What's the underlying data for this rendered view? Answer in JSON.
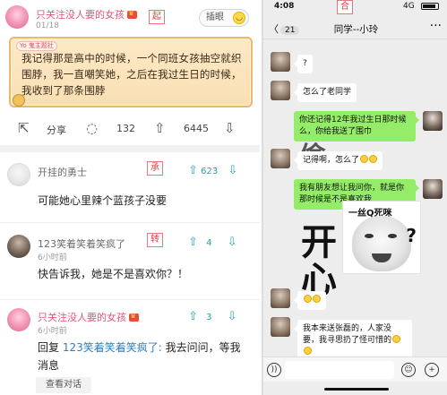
{
  "left": {
    "post": {
      "username": "只关注没人要的女孩",
      "date": "01/18",
      "tag": "起",
      "insert_label": "插眼",
      "parchment_label": "Yo 鬼主题社",
      "content": "我记得那是高中的时候，一个同班女孩抽空就织围脖，我一直嘲笑她，之后在我过生日的时候，我收到了那条围脖",
      "actions": {
        "share_label": "分享",
        "comments": "132",
        "upvotes": "6445"
      }
    },
    "comments": [
      {
        "username": "开挂的勇士",
        "tag": "承",
        "votes": "623",
        "text": "可能她心里辣个蓝孩子没要"
      },
      {
        "username": "123笑着笑着笑疯了",
        "time": "6小时前",
        "tag": "转",
        "votes": "4",
        "text": "快告诉我，她是不是喜欢你？！"
      },
      {
        "username": "只关注没人要的女孩",
        "time": "6小时前",
        "votes": "3",
        "reply_prefix": "回复",
        "reply_to": "123笑着笑着笑疯了:",
        "text_line1": "我去问问，等我",
        "text_line2": "消息",
        "view_label": "查看对话"
      }
    ]
  },
  "right": {
    "status": {
      "time": "4:08",
      "signal": "4G"
    },
    "tag": "合",
    "back_label": "〈",
    "back_badge": "21",
    "title": "同学--小玲",
    "more_label": "···",
    "messages": [
      {
        "dir": "in",
        "text": "?"
      },
      {
        "dir": "in",
        "text": "怎么了老同学"
      },
      {
        "dir": "out",
        "text": "你还记得12年我过生日那时候么，你给我送了围巾"
      },
      {
        "dir": "in",
        "text": "记得啊，怎么了"
      },
      {
        "dir": "out",
        "text": "我有朋友想让我问你，就是你那时候是不是喜欢我"
      },
      {
        "dir": "in",
        "text": ""
      },
      {
        "dir": "in",
        "text": "我本来送张磊的，人家没要，我寻思扔了怪可惜的"
      }
    ],
    "watermark": {
      "line1": "开",
      "line2": "心",
      "partial": "偷"
    },
    "meme": {
      "caption": "一丝Q死咪",
      "mark": "?"
    },
    "voice_icon": "))",
    "emoji_btn": "☺",
    "plus_btn": "+"
  },
  "colors": {
    "accent_pink": "#e0557c",
    "vote_teal": "#22a0a6",
    "wechat_green": "#95ec69",
    "tag_red": "#d23f3f"
  },
  "icons": [
    "share-icon",
    "comment-icon",
    "upvote-icon",
    "downvote-icon",
    "back-icon",
    "more-icon",
    "voice-icon",
    "emoji-icon",
    "plus-icon"
  ]
}
